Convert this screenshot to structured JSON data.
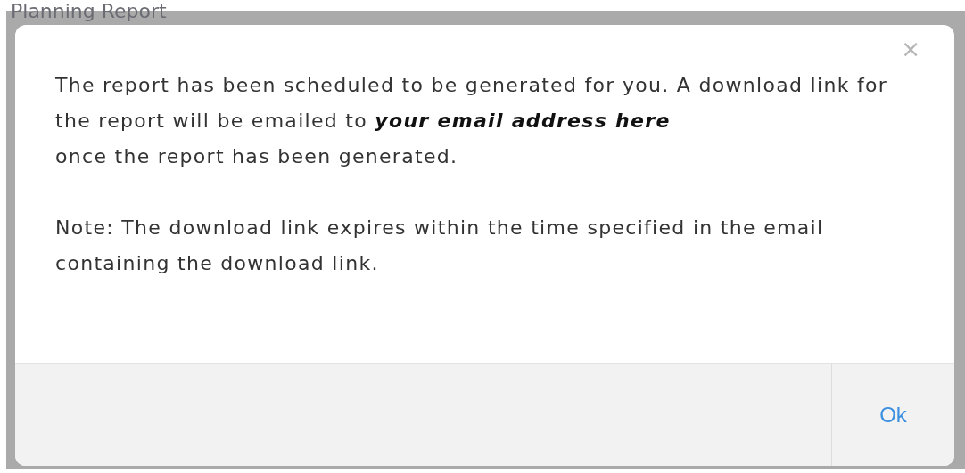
{
  "page": {
    "heading": "Planning Report"
  },
  "dialog": {
    "close": "×",
    "message": {
      "text": "The report has been scheduled to be generated for you. A download link for the report will be emailed to",
      "email": "your email address here",
      "after": "once the report has been generated."
    },
    "note": "Note: The download link expires within the time specified in the email containing the download link.",
    "buttons": [
      {
        "label": "Ok",
        "kind": "primary"
      }
    ]
  }
}
